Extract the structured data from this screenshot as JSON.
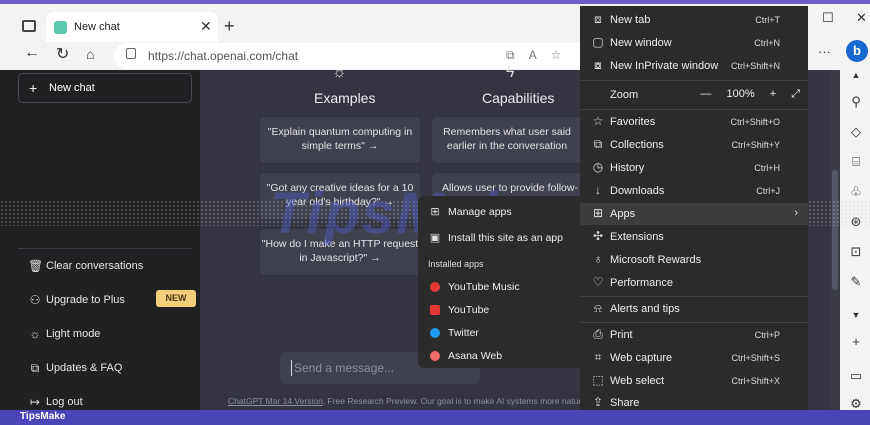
{
  "browser": {
    "tab_title": "New chat",
    "url": "https://chat.openai.com/chat"
  },
  "sidebar": {
    "new_chat": "New chat",
    "items": [
      {
        "icon": "trash-icon",
        "label": "Clear conversations"
      },
      {
        "icon": "user-icon",
        "label": "Upgrade to Plus",
        "badge": "NEW"
      },
      {
        "icon": "sun-icon",
        "label": "Light mode"
      },
      {
        "icon": "external-link-icon",
        "label": "Updates & FAQ"
      },
      {
        "icon": "logout-icon",
        "label": "Log out"
      }
    ]
  },
  "main": {
    "columns": [
      {
        "icon": "sun-icon",
        "title": "Examples",
        "cards": [
          "\"Explain quantum computing in simple terms\" →",
          "\"Got any creative ideas for a 10 year old's birthday?\" →",
          "\"How do I make an HTTP request in Javascript?\" →"
        ]
      },
      {
        "icon": "lightning-icon",
        "title": "Capabilities",
        "cards": [
          "Remembers what user said earlier in the conversation",
          "Allows user to provide follow-u"
        ]
      }
    ],
    "message_placeholder": "Send a message...",
    "footer_link": "ChatGPT Mar 14 Version",
    "footer_text": ". Free Research Preview. Our goal is to make AI systems more natural"
  },
  "apps_menu": {
    "manage": "Manage apps",
    "install": "Install this site as an app",
    "installed_header": "Installed apps",
    "apps": [
      {
        "label": "YouTube Music",
        "color": "#e53935"
      },
      {
        "label": "YouTube",
        "color": "#e53935"
      },
      {
        "label": "Twitter",
        "color": "#1d9bf0"
      },
      {
        "label": "Asana Web",
        "color": "#f06a6a"
      }
    ]
  },
  "browser_menu": {
    "new_tab": {
      "label": "New tab",
      "shortcut": "Ctrl+T"
    },
    "new_window": {
      "label": "New window",
      "shortcut": "Ctrl+N"
    },
    "inprivate": {
      "label": "New InPrivate window",
      "shortcut": "Ctrl+Shift+N"
    },
    "zoom": {
      "label": "Zoom",
      "minus": "—",
      "value": "100%",
      "plus": "+",
      "expand": "⤢"
    },
    "favorites": {
      "label": "Favorites",
      "shortcut": "Ctrl+Shift+O"
    },
    "collections": {
      "label": "Collections",
      "shortcut": "Ctrl+Shift+Y"
    },
    "history": {
      "label": "History",
      "shortcut": "Ctrl+H"
    },
    "downloads": {
      "label": "Downloads",
      "shortcut": "Ctrl+J"
    },
    "apps": {
      "label": "Apps"
    },
    "extensions": {
      "label": "Extensions"
    },
    "rewards": {
      "label": "Microsoft Rewards"
    },
    "performance": {
      "label": "Performance"
    },
    "alerts": {
      "label": "Alerts and tips"
    },
    "print": {
      "label": "Print",
      "shortcut": "Ctrl+P"
    },
    "web_capture": {
      "label": "Web capture",
      "shortcut": "Ctrl+Shift+S"
    },
    "web_select": {
      "label": "Web select",
      "shortcut": "Ctrl+Shift+X"
    },
    "share": {
      "label": "Share"
    }
  },
  "watermark": "TipsMake",
  "brand": "TipsMake"
}
